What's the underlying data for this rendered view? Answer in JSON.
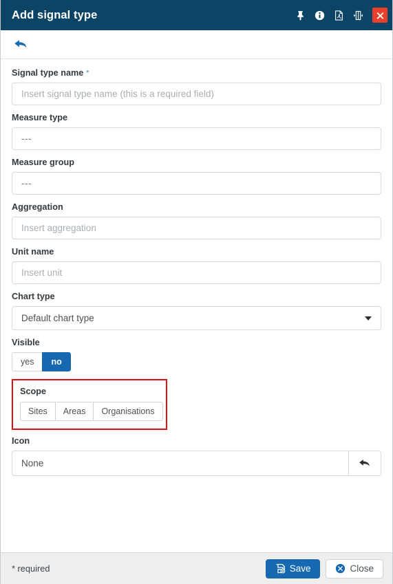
{
  "titlebar": {
    "title": "Add signal type",
    "icons": [
      {
        "name": "pin-icon",
        "label": "Pin"
      },
      {
        "name": "info-icon",
        "label": "Info"
      },
      {
        "name": "pdf-icon",
        "label": "Export PDF"
      },
      {
        "name": "resize-icon",
        "label": "Resize"
      }
    ],
    "close_label": "x"
  },
  "toolbar": {
    "back_label": "Back"
  },
  "form": {
    "signal_type_name": {
      "label": "Signal type name",
      "required_marker": "*",
      "value": "",
      "placeholder": "Insert signal type name (this is a required field)"
    },
    "measure_type": {
      "label": "Measure type",
      "value": "---"
    },
    "measure_group": {
      "label": "Measure group",
      "value": "---"
    },
    "aggregation": {
      "label": "Aggregation",
      "value": "",
      "placeholder": "Insert aggregation"
    },
    "unit_name": {
      "label": "Unit name",
      "value": "",
      "placeholder": "Insert unit"
    },
    "chart_type": {
      "label": "Chart type",
      "value": "Default chart type"
    },
    "visible": {
      "label": "Visible",
      "options": [
        {
          "label": "yes",
          "selected": false
        },
        {
          "label": "no",
          "selected": true
        }
      ]
    },
    "scope": {
      "label": "Scope",
      "highlight_color": "#dd1111",
      "options": [
        {
          "label": "Sites",
          "selected": false
        },
        {
          "label": "Areas",
          "selected": false
        },
        {
          "label": "Organisations",
          "selected": false
        }
      ]
    },
    "icon": {
      "label": "Icon",
      "value": "None",
      "reset_button": "reset-icon"
    }
  },
  "footer": {
    "required_note": "* required",
    "save_label": "Save",
    "close_label": "Close"
  },
  "colors": {
    "titlebar_bg": "#0c4466",
    "accent_blue": "#1668b0",
    "close_red": "#e8402a",
    "highlight_red": "#dd1111",
    "footer_bg": "#eeeeee"
  }
}
